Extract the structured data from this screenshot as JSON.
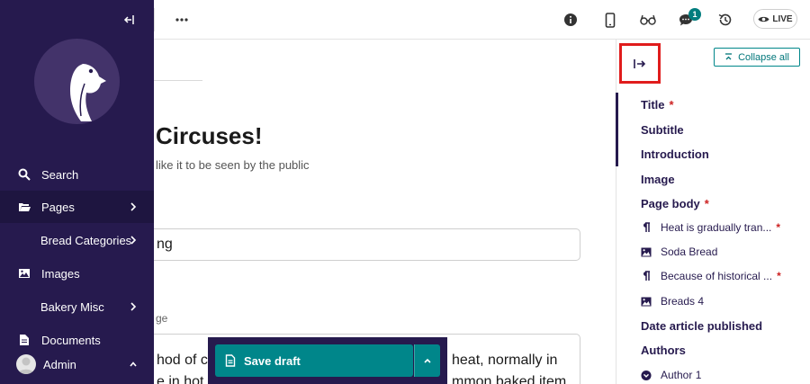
{
  "sidebar": {
    "collapse_icon": "collapse-left-icon",
    "nav": [
      {
        "label": "Search",
        "icon": "search-icon"
      },
      {
        "label": "Pages",
        "icon": "folder-open-icon"
      },
      {
        "label": "Bread Categories",
        "icon": ""
      },
      {
        "label": "Images",
        "icon": "image-icon"
      },
      {
        "label": "Bakery Misc",
        "icon": ""
      },
      {
        "label": "Documents",
        "icon": "document-icon"
      }
    ],
    "user": {
      "label": "Admin"
    }
  },
  "topbar": {
    "more_icon": "more-horizontal-icon",
    "icons": [
      "info-icon",
      "mobile-preview-icon",
      "glasses-icon",
      "comment-icon",
      "history-icon"
    ],
    "comment_count": "1",
    "live_label": "LIVE"
  },
  "editor": {
    "title": "Circuses!",
    "subtitle": "like it to be seen by the public",
    "field_value": "ng",
    "field_help": "ge",
    "body_line1_a": "hod of co",
    "body_line1_b": "heat, normally in",
    "body_line2_a": "e in hot",
    "body_line2_b": "mmon baked item"
  },
  "save": {
    "label": "Save draft"
  },
  "minimap": {
    "toggle_icon": "expand-right-icon",
    "collapse_all": "Collapse all",
    "items": [
      {
        "label": "Title",
        "required": true
      },
      {
        "label": "Subtitle",
        "required": false
      },
      {
        "label": "Introduction",
        "required": false
      },
      {
        "label": "Image",
        "required": false
      },
      {
        "label": "Page body",
        "required": true
      }
    ],
    "blocks": [
      {
        "label": "Heat is gradually tran...",
        "icon": "pilcrow-icon",
        "required": true
      },
      {
        "label": "Soda Bread",
        "icon": "image-icon",
        "required": false
      },
      {
        "label": "Because of historical ...",
        "icon": "pilcrow-icon",
        "required": true
      },
      {
        "label": "Breads 4",
        "icon": "image-icon",
        "required": false
      }
    ],
    "items_after": [
      {
        "label": "Date article published"
      },
      {
        "label": "Authors"
      }
    ],
    "author": {
      "label": "Author 1",
      "icon": "chevron-circle-down-icon"
    },
    "required_mark": "*"
  },
  "colors": {
    "sidebar": "#261a4e",
    "accent": "#00868a",
    "highlight": "#e01c1c",
    "required": "#cd2222"
  }
}
